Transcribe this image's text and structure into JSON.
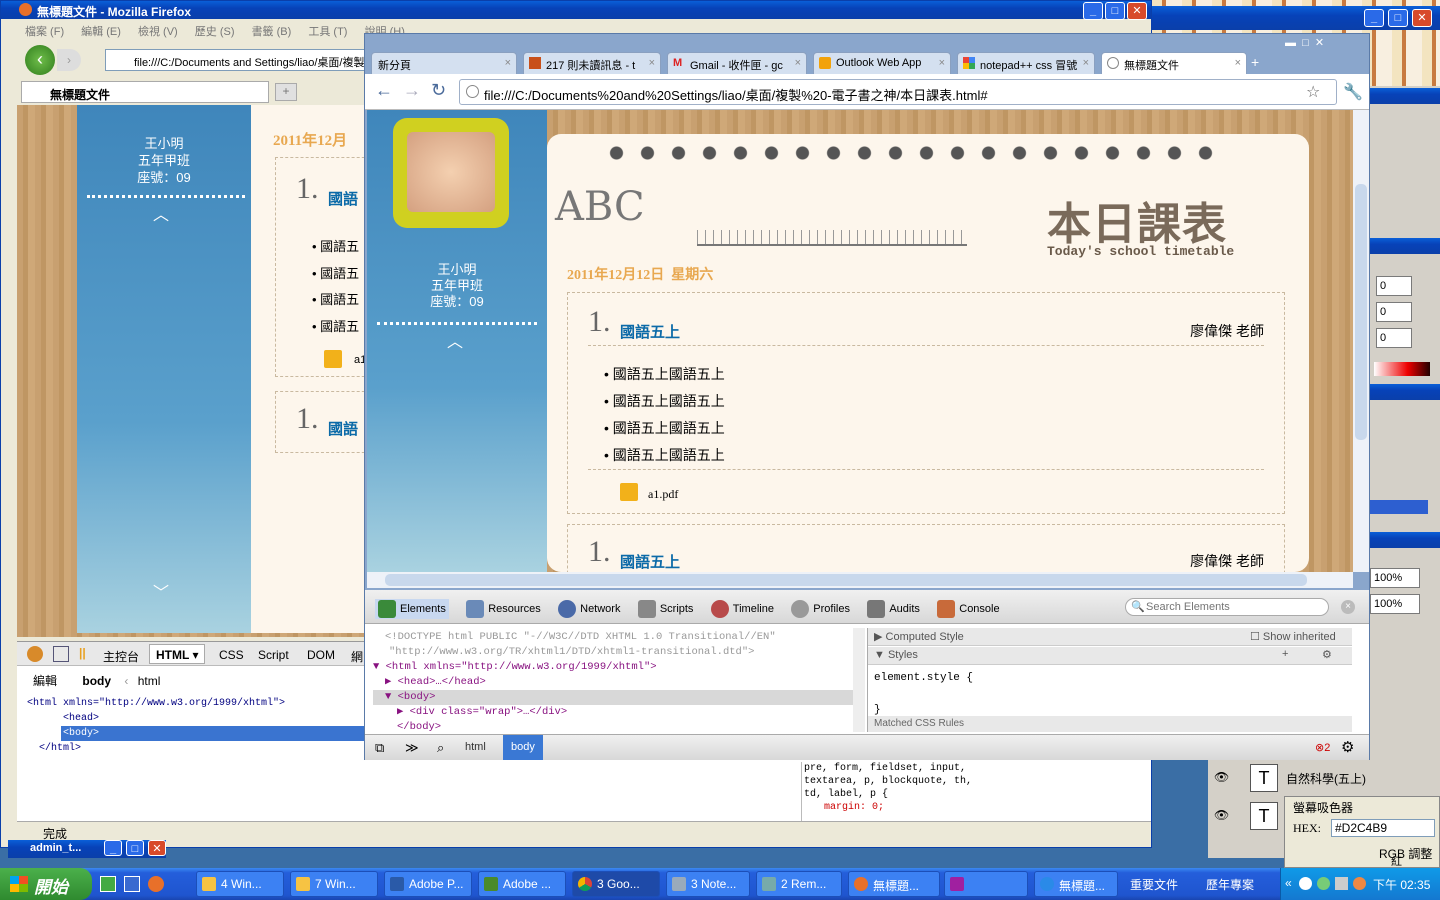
{
  "firefox": {
    "title": "無標題文件 - Mozilla Firefox",
    "menu": [
      "檔案 (F)",
      "編輯 (E)",
      "檢視 (V)",
      "歷史 (S)",
      "書籤 (B)",
      "工具 (T)",
      "說明 (H)"
    ],
    "url": "file:///C:/Documents and Settings/liao/桌面/複製",
    "tab": "無標題文件",
    "status": "完成",
    "student": {
      "name": "王小明",
      "class": "五年甲班",
      "seat": "座號：09"
    },
    "date": "2011年12月",
    "lesson1_num": "1.",
    "lesson1_title": "國語",
    "bullet": "國語五",
    "pdf": "a1",
    "lesson2_num": "1.",
    "lesson2_title": "國語",
    "firebug": {
      "tabs": [
        "主控台",
        "HTML",
        "CSS",
        "Script",
        "DOM",
        "網"
      ],
      "edit": "編輯",
      "crumb1": "body",
      "crumb2": "html",
      "tree": [
        "<html xmlns=\"http://www.w3.org/1999/xhtml\">",
        "<head>",
        "<body>",
        "</html>"
      ],
      "css": [
        "pre, form, fieldset, input,",
        "textarea, p, blockquote, th,",
        "td, label, p {",
        "margin: 0;"
      ]
    }
  },
  "chrome": {
    "tabs": [
      "新分頁",
      "217 則未讀訊息 - t",
      "Gmail - 收件匣 - gc",
      "Outlook Web App",
      "notepad++ css 冒號",
      "無標題文件"
    ],
    "url": "file:///C:/Documents%20and%20Settings/liao/桌面/複製%20-電子書之神/本日課表.html#",
    "student": {
      "name": "王小明",
      "class": "五年甲班",
      "seat": "座號：09"
    },
    "banner_title": "本日課表",
    "banner_sub": "Today's school timetable",
    "date": "2011年12月12日  星期六",
    "lesson1": {
      "num": "1.",
      "title": "國語五上",
      "teacher": "廖偉傑 老師",
      "items": [
        "國語五上國語五上",
        "國語五上國語五上",
        "國語五上國語五上",
        "國語五上國語五上"
      ],
      "file": "a1.pdf"
    },
    "lesson2": {
      "num": "1.",
      "title": "國語五上",
      "teacher": "廖偉傑 老師"
    },
    "devtools": {
      "tools": [
        "Elements",
        "Resources",
        "Network",
        "Scripts",
        "Timeline",
        "Profiles",
        "Audits",
        "Console"
      ],
      "search_placeholder": "Search Elements",
      "dom": [
        "<!DOCTYPE html PUBLIC \"-//W3C//DTD XHTML 1.0 Transitional//EN\"",
        "\"http://www.w3.org/TR/xhtml1/DTD/xhtml1-transitional.dtd\">",
        "<html xmlns=\"http://www.w3.org/1999/xhtml\">",
        "<head>…</head>",
        "<body>",
        "<div class=\"wrap\">…</div>",
        "</body>"
      ],
      "computed": "Computed Style",
      "show_inherited": "Show inherited",
      "styles": "Styles",
      "element_style": "element.style {",
      "close_brace": "}",
      "matched": "Matched CSS Rules",
      "crumbs": [
        "html",
        "body"
      ],
      "errors": "2"
    }
  },
  "right_panel": {
    "values": [
      "0",
      "0",
      "0"
    ],
    "pct1": "100%",
    "pct2": "100%",
    "layer1": "自然科學(五上)",
    "eyedropper": "螢幕吸色器",
    "hex_label": "HEX:",
    "hex": "#D2C4B9",
    "rgb": "RGB 調整",
    "rgb2": "紅"
  },
  "taskbar": {
    "start": "開始",
    "items": [
      "4 Win...",
      "7 Win...",
      "Adobe P...",
      "Adobe ...",
      "3 Goo...",
      "3 Note...",
      "2 Rem...",
      "無標題...",
      "",
      "無標題..."
    ],
    "tray1": "重要文件",
    "tray2": "歷年專案",
    "clock": "下午 02:35"
  },
  "admin": "admin_t..."
}
